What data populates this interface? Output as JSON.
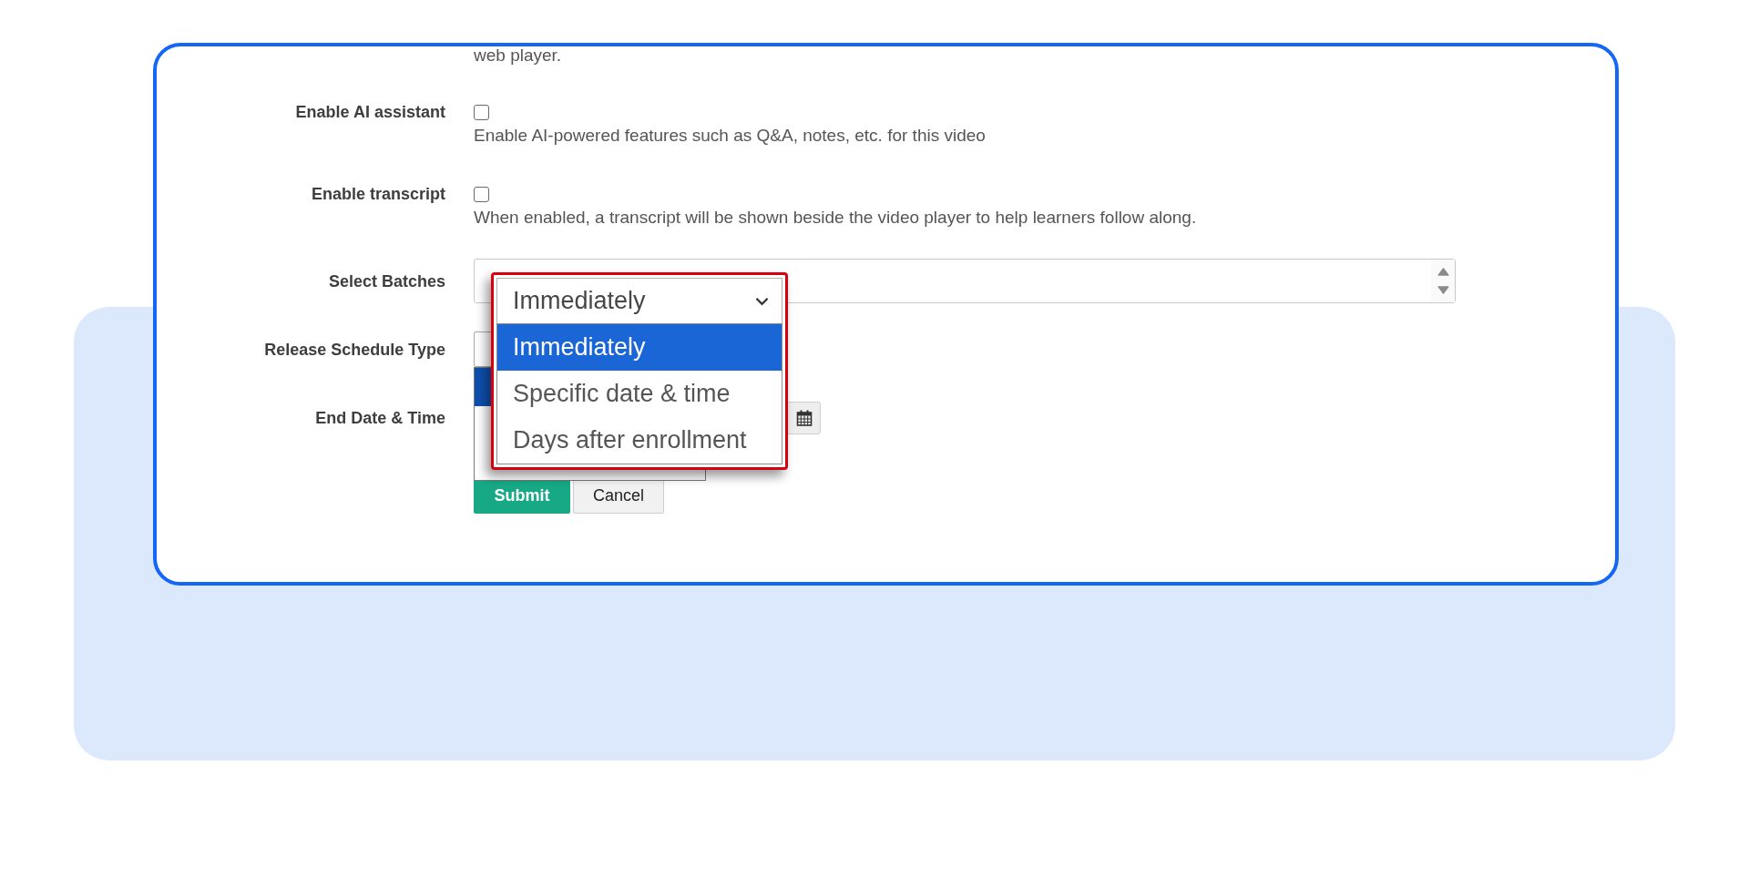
{
  "form": {
    "help_text_above": "web player.",
    "fields": [
      {
        "kind": "checkbox",
        "label": "Enable AI assistant",
        "checked": false,
        "help": "Enable AI-powered features such as Q&A, notes, etc. for this video"
      },
      {
        "kind": "checkbox",
        "label": "Enable transcript",
        "checked": false,
        "help": "When enabled, a transcript will be shown beside the video player to help learners follow along."
      },
      {
        "kind": "multiselect",
        "label": "Select Batches"
      },
      {
        "kind": "select",
        "label": "Release Schedule Type",
        "dropdown": {
          "value": "Immediately",
          "options": [
            {
              "label": "Immediately",
              "selected": true
            },
            {
              "label": "Specific date & time",
              "selected": false
            },
            {
              "label": "Days after enrollment",
              "selected": false
            }
          ]
        }
      },
      {
        "kind": "datetime",
        "label": "End Date & Time"
      }
    ],
    "buttons": [
      {
        "kind": "primary",
        "label": "Submit"
      },
      {
        "kind": "secondary",
        "label": "Cancel"
      }
    ]
  }
}
